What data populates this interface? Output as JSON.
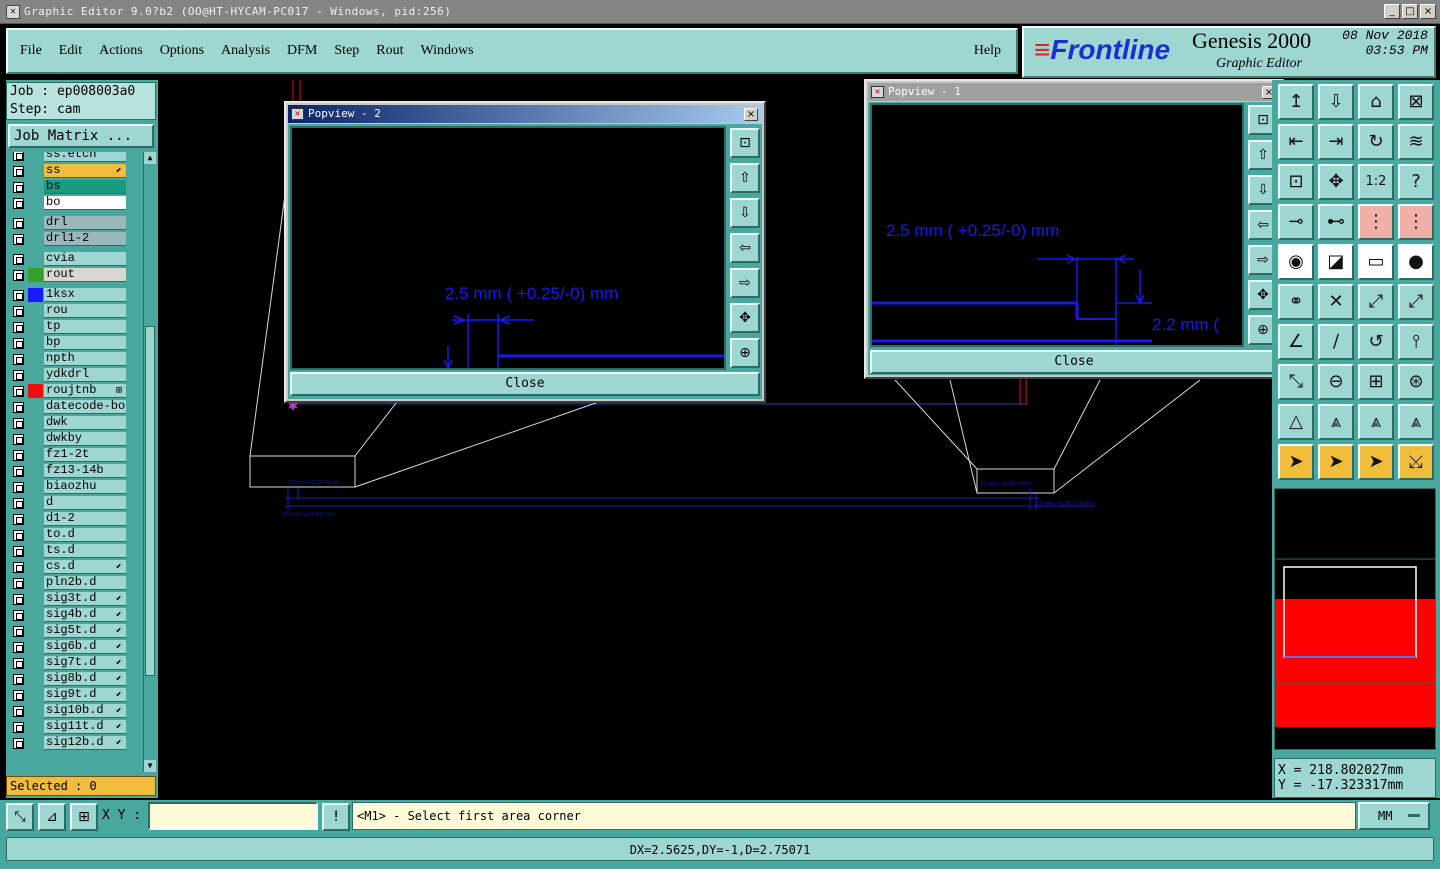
{
  "window": {
    "title": "Graphic Editor 9.0?b2 (OO@HT-HYCAM-PC017 - Windows, pid:256)",
    "icon": "app-icon",
    "min": "_",
    "max": "□",
    "close": "×"
  },
  "menu": {
    "items": [
      "File",
      "Edit",
      "Actions",
      "Options",
      "Analysis",
      "DFM",
      "Step",
      "Rout",
      "Windows"
    ],
    "help": "Help"
  },
  "brand": {
    "logo_text": "Frontline",
    "product": "Genesis 2000",
    "subtitle": "Graphic Editor",
    "date": "08 Nov 2018",
    "time": "03:53 PM"
  },
  "job": {
    "job_label": "Job : ep008003a0",
    "step_label": "Step: cam",
    "matrix_button": "Job Matrix ..."
  },
  "layers": [
    {
      "name": "ss.etch",
      "color": "",
      "bg": "#9ed6d2",
      "mark": ""
    },
    {
      "name": "ss",
      "color": "",
      "bg": "#f0bc3c",
      "mark": "⬋"
    },
    {
      "name": "bs",
      "color": "",
      "bg": "#1a9a80",
      "mark": ""
    },
    {
      "name": "bo",
      "color": "",
      "bg": "#ffffff",
      "mark": ""
    },
    {
      "name": "drl",
      "color": "",
      "bg": "#9ab8bc",
      "mark": ""
    },
    {
      "name": "drl1-2",
      "color": "",
      "bg": "#9ab8bc",
      "mark": ""
    },
    {
      "name": "cvia",
      "color": "",
      "bg": "#9ed6d2",
      "mark": ""
    },
    {
      "name": "rout",
      "color": "#33a02c",
      "bg": "#d8d8d0",
      "mark": ""
    },
    {
      "name": "1ksx",
      "color": "#1a1aff",
      "bg": "#9ed6d2",
      "mark": ""
    },
    {
      "name": "rou",
      "color": "",
      "bg": "#9ed6d2",
      "mark": ""
    },
    {
      "name": "tp",
      "color": "",
      "bg": "#9ed6d2",
      "mark": ""
    },
    {
      "name": "bp",
      "color": "",
      "bg": "#9ed6d2",
      "mark": ""
    },
    {
      "name": "npth",
      "color": "",
      "bg": "#9ed6d2",
      "mark": ""
    },
    {
      "name": "ydkdrl",
      "color": "",
      "bg": "#9ed6d2",
      "mark": ""
    },
    {
      "name": "roujtnb",
      "color": "#ee1010",
      "bg": "#9ed6d2",
      "mark": "⊞"
    },
    {
      "name": "datecode-bo",
      "color": "",
      "bg": "#9ed6d2",
      "mark": ""
    },
    {
      "name": "dwk",
      "color": "",
      "bg": "#9ed6d2",
      "mark": ""
    },
    {
      "name": "dwkby",
      "color": "",
      "bg": "#9ed6d2",
      "mark": ""
    },
    {
      "name": "fz1-2t",
      "color": "",
      "bg": "#9ed6d2",
      "mark": ""
    },
    {
      "name": "fz13-14b",
      "color": "",
      "bg": "#9ed6d2",
      "mark": ""
    },
    {
      "name": "biaozhu",
      "color": "",
      "bg": "#9ed6d2",
      "mark": ""
    },
    {
      "name": "d",
      "color": "",
      "bg": "#9ed6d2",
      "mark": ""
    },
    {
      "name": "d1-2",
      "color": "",
      "bg": "#9ed6d2",
      "mark": ""
    },
    {
      "name": "to.d",
      "color": "",
      "bg": "#9ed6d2",
      "mark": ""
    },
    {
      "name": "ts.d",
      "color": "",
      "bg": "#9ed6d2",
      "mark": ""
    },
    {
      "name": "cs.d",
      "color": "",
      "bg": "#9ed6d2",
      "mark": "⬋"
    },
    {
      "name": "pln2b.d",
      "color": "",
      "bg": "#9ed6d2",
      "mark": ""
    },
    {
      "name": "sig3t.d",
      "color": "",
      "bg": "#9ed6d2",
      "mark": "⬋"
    },
    {
      "name": "sig4b.d",
      "color": "",
      "bg": "#9ed6d2",
      "mark": "⬋"
    },
    {
      "name": "sig5t.d",
      "color": "",
      "bg": "#9ed6d2",
      "mark": "⬋"
    },
    {
      "name": "sig6b.d",
      "color": "",
      "bg": "#9ed6d2",
      "mark": "⬋"
    },
    {
      "name": "sig7t.d",
      "color": "",
      "bg": "#9ed6d2",
      "mark": "⬋"
    },
    {
      "name": "sig8b.d",
      "color": "",
      "bg": "#9ed6d2",
      "mark": "⬋"
    },
    {
      "name": "sig9t.d",
      "color": "",
      "bg": "#9ed6d2",
      "mark": "⬋"
    },
    {
      "name": "sig10b.d",
      "color": "",
      "bg": "#9ed6d2",
      "mark": "⬋"
    },
    {
      "name": "sig11t.d",
      "color": "",
      "bg": "#9ed6d2",
      "mark": "⬋"
    },
    {
      "name": "sig12b.d",
      "color": "",
      "bg": "#9ed6d2",
      "mark": "⬋"
    }
  ],
  "selected": "Selected : 0",
  "popview2": {
    "title": "Popview - 2",
    "annotation": "2.5 mm ( +0.25/-0) mm",
    "close_label": "Close"
  },
  "popview1": {
    "title": "Popview - 1",
    "annotation": "2.5 mm ( +0.25/-0) mm",
    "annotation2": "2.2 mm (",
    "close_label": "Close"
  },
  "tools": [
    "↥",
    "⇩",
    "⌂",
    "⊠",
    "⇤",
    "⇥",
    "↻",
    "≋",
    "⊡",
    "✥",
    "1:2",
    "?",
    "⊸",
    "⊷",
    "⋮",
    "⋮",
    "◉",
    "◪",
    "▭",
    "●",
    "⚭",
    "✕",
    "⤢",
    "⤢",
    "∠",
    "∕",
    "↺",
    "⫯",
    "⤡",
    "⊖",
    "⊞",
    "⊛",
    "△",
    "⩓",
    "⩓",
    "⩓",
    "➤",
    "➤",
    "➤",
    "⤩"
  ],
  "coords": {
    "x": "X = 218.802027mm",
    "y": "Y = -17.323317mm"
  },
  "status": {
    "xy_label": "X Y :",
    "xy_value": "",
    "message": "<M1> - Select first area corner",
    "units": "MM",
    "measure": "DX=2.5625,DY=-1,D=2.75071"
  },
  "colors": {
    "panel": "#48a89e",
    "button": "#9ed6d2",
    "annotation_blue": "#1818f0",
    "highlight": "#f0bc3c"
  }
}
